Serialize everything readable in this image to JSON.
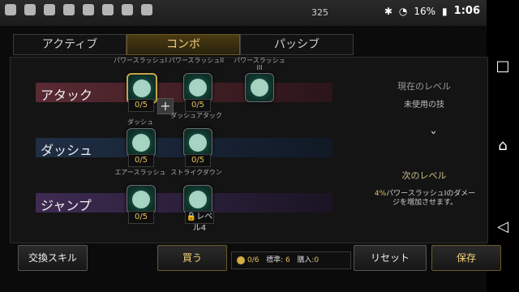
{
  "status_bar": {
    "number": "325",
    "battery_percent": "16%",
    "time": "1:06"
  },
  "tabs": [
    {
      "label": "アクティブ"
    },
    {
      "label": "コンボ"
    },
    {
      "label": "パッシブ"
    }
  ],
  "rows": [
    {
      "label": "アタック",
      "color": "#5a2a33"
    },
    {
      "label": "ダッシュ",
      "color": "#1d2a3a"
    },
    {
      "label": "ジャンプ",
      "color": "#3a2a48"
    }
  ],
  "skills": [
    {
      "name": "パワースラッシュI",
      "level": "0/5"
    },
    {
      "name": "パワースラッシュII",
      "level": "0/5"
    },
    {
      "name": "パワースラッシュIII",
      "level": ""
    },
    {
      "name": "ダッシュ",
      "level": "0/5"
    },
    {
      "name": "ダッシュアタック",
      "level": "0/5"
    },
    {
      "name": "エアースラッシュ",
      "level": "0/5"
    },
    {
      "name": "ストライクダウン",
      "level": "レベル4"
    }
  ],
  "right_panel": {
    "current_level_label": "現在のレベル",
    "current_level_value": "未使用の技",
    "next_level_label": "次のレベル",
    "next_desc_pct": "4%",
    "next_desc_text": "パワースラッシュIのダメージを増加させます。"
  },
  "buttons": {
    "exchange": "交換スキル",
    "buy": "買う",
    "reset": "リセット",
    "save": "保存"
  },
  "stats": {
    "coins": "0/6",
    "standard_label": "標準:",
    "standard_value": "6",
    "purchase_label": "購入:",
    "purchase_value": "0"
  }
}
